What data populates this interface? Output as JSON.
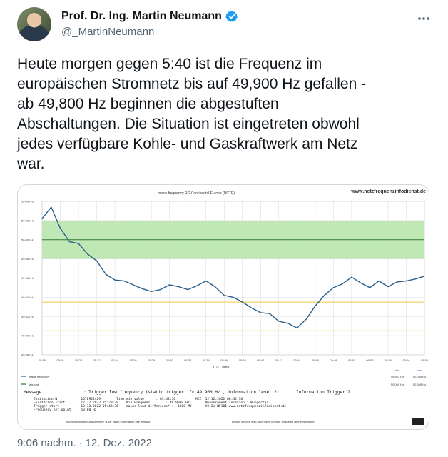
{
  "author": {
    "display_name": "Prof. Dr. Ing. Martin Neumann",
    "handle": "@_MartinNeumann",
    "verified_color": "#1d9bf0"
  },
  "tweet": {
    "text_lines": [
      "Heute morgen gegen 5:40 ist die Frequenz im",
      "europäischen Stromnetz bis auf 49,900 Hz gefallen -",
      "ab 49,800 Hz beginnen die abgestuften",
      "Abschaltungen. Die Situation ist eingetreten obwohl",
      "jedes verfügbare Kohle- und Gaskraftwerk am Netz",
      "war."
    ],
    "time": "9:06 nachm.",
    "separator": "·",
    "date": "12. Dez. 2022"
  },
  "chart_data": {
    "type": "line",
    "title": "mains frequency RG Continental Europe (UCTE)",
    "source_label": "www.netzfrequenzinfodienst.de",
    "xlabel": "UTC Time",
    "y_ticks": [
      "50.040 Hz",
      "50.020 Hz",
      "50.000 Hz",
      "49.980 Hz",
      "49.960 Hz",
      "49.940 Hz",
      "49.920 Hz",
      "49.900 Hz",
      "49.880 Hz"
    ],
    "ylim": [
      49.88,
      50.04
    ],
    "x_ticks": [
      "05:16",
      "05:18",
      "05:20",
      "05:22",
      "05:24",
      "05:26",
      "05:28",
      "05:30",
      "05:32",
      "05:34",
      "05:36",
      "05:38",
      "05:40",
      "05:42",
      "05:44",
      "05:46",
      "05:48",
      "05:50",
      "05:52",
      "05:54",
      "05:56",
      "05:58"
    ],
    "xlim": [
      0,
      42
    ],
    "deadband": [
      49.98,
      50.02
    ],
    "nominal": 50.0,
    "threshold_lines": [
      49.935,
      49.905
    ],
    "colors": {
      "line": "#2b5d8a",
      "band": "#bfe8b4",
      "nominal": "#2e7d32",
      "threshold": "#f2d36b",
      "grid": "#d8d8d8"
    },
    "x": [
      0,
      1,
      2,
      3,
      4,
      5,
      6,
      7,
      8,
      9,
      10,
      11,
      12,
      13,
      14,
      15,
      16,
      17,
      18,
      19,
      20,
      21,
      22,
      23,
      24,
      25,
      26,
      27,
      28,
      29,
      30,
      31,
      32,
      33,
      34,
      35,
      36,
      37,
      38,
      39,
      40,
      41,
      42
    ],
    "values": [
      50.022,
      50.034,
      50.012,
      49.998,
      49.996,
      49.985,
      49.978,
      49.964,
      49.958,
      49.957,
      49.953,
      49.949,
      49.946,
      49.948,
      49.953,
      49.951,
      49.948,
      49.952,
      49.957,
      49.951,
      49.942,
      49.94,
      49.935,
      49.929,
      49.924,
      49.923,
      49.915,
      49.913,
      49.908,
      49.917,
      49.931,
      49.942,
      49.95,
      49.954,
      49.961,
      49.955,
      49.95,
      49.957,
      49.951,
      49.956,
      49.957,
      49.959,
      49.962
    ],
    "legend": [
      {
        "label": "mains frequency",
        "value_label": "49.997 Hz",
        "max_label": "50.034 Hz"
      },
      {
        "label": "setpoint",
        "value_label": "50.000 Hz",
        "max_label": "50.000 Hz"
      }
    ],
    "legend_headers": [
      "min",
      "max"
    ],
    "message_header": "Message",
    "message_text": ": Trigger low frequency (static trigger, f< 49,900 Hz , information level 2)",
    "message_right": "Information Trigger 2",
    "info_lines": [
      "Excitation Nr         : 1670922429        Time min value      : 05:42:36          MEZ  12.12.2022 06:42:36",
      "Excitation start      : 12.12.2022 05:20:29    Min Frequenz        : 49.9080 Hz        Measurement location : Wuppertal",
      "Trigger start         : 12.12.2022 05:42:36    mains load difference* : -1300 MW       V2.2c NF101 www.netzfrequenzinfodienst.de",
      "Frequency set point   : 50.00 Hz"
    ],
    "footer_left": "Information without guarantee    *1 for value-information see website.",
    "footer_right": "Dieser Service wird durch Ihre Spende finanziert (siehe Webseite)",
    "grid": true,
    "legend_position": "bottom"
  }
}
